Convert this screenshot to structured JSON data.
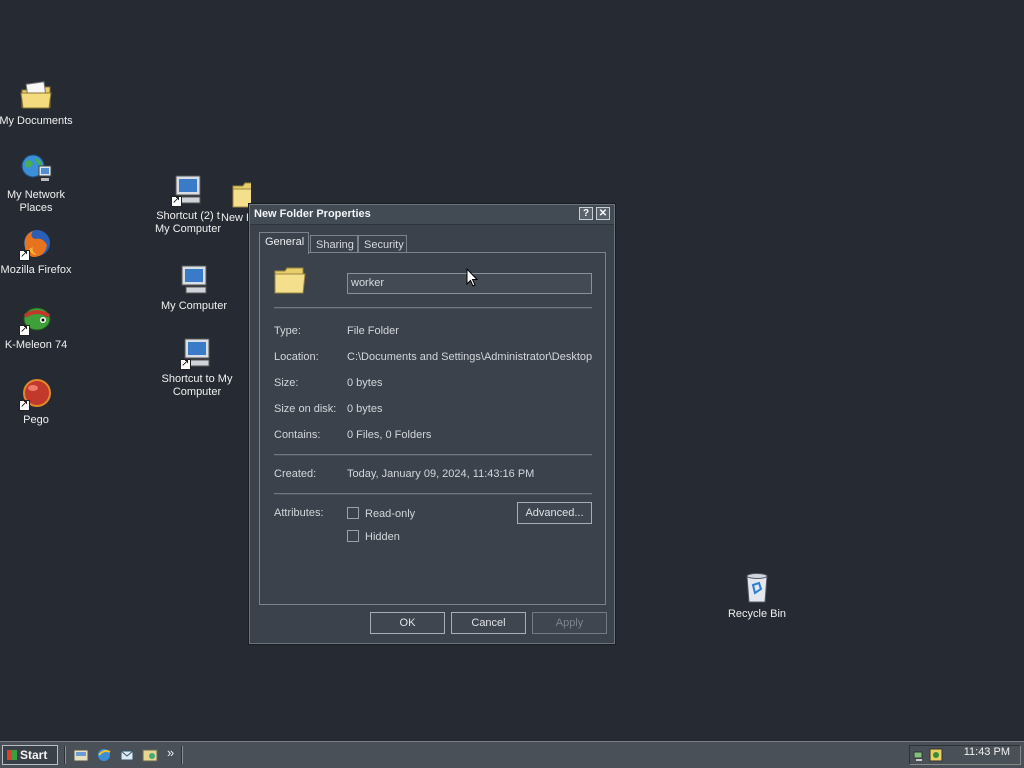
{
  "desktop": {
    "icons": [
      {
        "label": "My Documents"
      },
      {
        "label": "My Network Places"
      },
      {
        "label": "Mozilla Firefox"
      },
      {
        "label": "K-Meleon 74"
      },
      {
        "label": "Pego"
      },
      {
        "label": "Shortcut (2) t My Computer"
      },
      {
        "label": "New F"
      },
      {
        "label": "My Computer"
      },
      {
        "label": "Shortcut to My Computer"
      },
      {
        "label": "Recycle Bin"
      }
    ]
  },
  "window": {
    "title": "New Folder Properties",
    "help_label": "?",
    "close_label": "✕",
    "tabs": [
      {
        "label": "General",
        "active": true
      },
      {
        "label": "Sharing",
        "active": false
      },
      {
        "label": "Security",
        "active": false
      }
    ],
    "name_value": "worker",
    "fields": {
      "type_label": "Type:",
      "type_value": "File Folder",
      "location_label": "Location:",
      "location_value": "C:\\Documents and Settings\\Administrator\\Desktop",
      "size_label": "Size:",
      "size_value": "0 bytes",
      "size_on_disk_label": "Size on disk:",
      "size_on_disk_value": "0 bytes",
      "contains_label": "Contains:",
      "contains_value": "0 Files, 0 Folders",
      "created_label": "Created:",
      "created_value": "Today, January 09, 2024, 11:43:16 PM",
      "attributes_label": "Attributes:",
      "readonly_label": "Read-only",
      "hidden_label": "Hidden",
      "advanced_label": "Advanced..."
    },
    "buttons": {
      "ok": "OK",
      "cancel": "Cancel",
      "apply": "Apply"
    }
  },
  "taskbar": {
    "start_label": "Start",
    "overflow_label": "»",
    "clock": "11:43 PM"
  },
  "colors": {
    "desktop_bg": "#262b33",
    "window_bg": "#3b424b",
    "folder_yellow": "#f3e08a"
  }
}
